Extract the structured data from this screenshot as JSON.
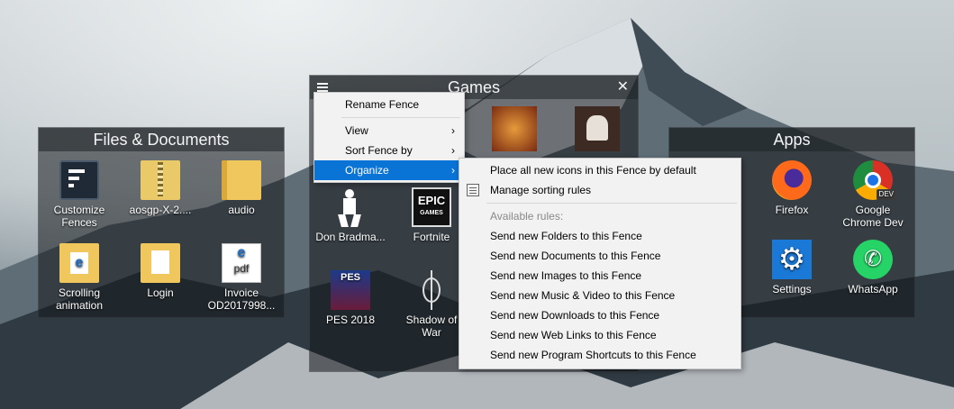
{
  "fences": {
    "files": {
      "title": "Files & Documents",
      "items": [
        "Customize Fences",
        "aosgp-X-2....",
        "audio",
        "Scrolling animation",
        "Login",
        "Invoice OD2017998..."
      ]
    },
    "games": {
      "title": "Games",
      "items": [
        "Don Bradma...",
        "Fortnite",
        "PES 2018",
        "Shadow of War"
      ],
      "fortnite_logo_text": [
        "EPIC",
        "GAMES"
      ],
      "pes_logo_text": "PES"
    },
    "apps": {
      "title": "Apps",
      "items": [
        "Firefox",
        "Google Chrome Dev",
        "Settings",
        "WhatsApp"
      ],
      "chrome_badge": "DEV"
    }
  },
  "context_menu": {
    "items": [
      "Rename Fence",
      "View",
      "Sort Fence by",
      "Organize"
    ],
    "highlighted": "Organize"
  },
  "submenu": {
    "place_default": "Place all new icons in this Fence by default",
    "manage_rules": "Manage sorting rules",
    "available_label": "Available rules:",
    "rules": [
      "Send new Folders to this Fence",
      "Send new Documents to this Fence",
      "Send new Images to this Fence",
      "Send new Music & Video to this Fence",
      "Send new Downloads to this Fence",
      "Send new Web Links to this Fence",
      "Send new Program Shortcuts to this Fence"
    ]
  },
  "icons": {
    "hamburger": "hamburger-icon",
    "close": "close-icon",
    "submenu_arrow": "chevron-right-icon"
  },
  "colors": {
    "highlight": "#0a73d6",
    "menu_bg": "#f2f2f2",
    "fence_bg": "rgba(20,24,28,0.55)"
  }
}
